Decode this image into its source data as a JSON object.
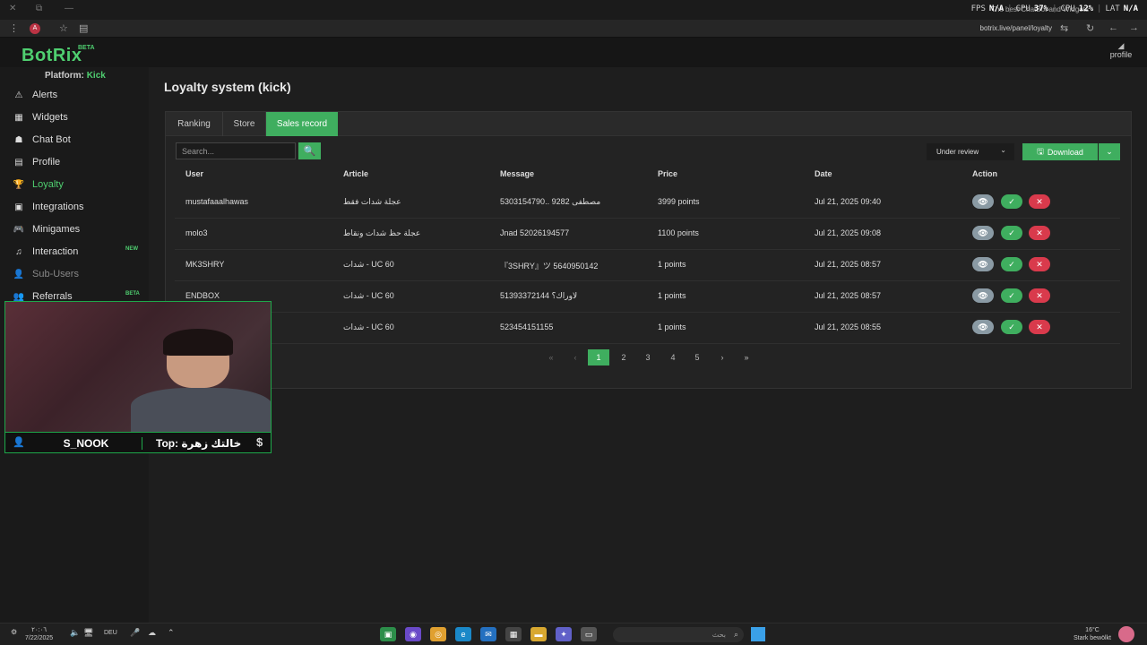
{
  "browser": {
    "window_controls": [
      "✕",
      "⧉",
      "—"
    ],
    "fps": {
      "fps_label": "FPS",
      "fps_val": "N/A",
      "gpu_label": "GPU",
      "gpu_val": "37%",
      "cpu_label": "CPU",
      "cpu_val": "12%",
      "lat_label": "LAT",
      "lat_val": "N/A"
    },
    "overlay_title": "The best ChatBot and Widgets",
    "url": "botrix.live/panel/loyalty"
  },
  "app": {
    "logo": "BotRix",
    "beta": "BETA",
    "platform_label": "Platform:",
    "platform_value": "Kick",
    "profile_label": "profile"
  },
  "sidebar": {
    "items": [
      {
        "label": "Alerts",
        "icon": "⚠"
      },
      {
        "label": "Widgets",
        "icon": "▦"
      },
      {
        "label": "Chat Bot",
        "icon": "☗"
      },
      {
        "label": "Profile",
        "icon": "▤"
      },
      {
        "label": "Loyalty",
        "icon": "🏆"
      },
      {
        "label": "Integrations",
        "icon": "▣"
      },
      {
        "label": "Minigames",
        "icon": "🎮"
      },
      {
        "label": "Interaction",
        "icon": "♫",
        "badge": "NEW"
      },
      {
        "label": "Sub-Users",
        "icon": "👤"
      },
      {
        "label": "Referrals",
        "icon": "👥",
        "badge": "BETA"
      }
    ]
  },
  "main": {
    "title": "Loyalty system (kick)",
    "tabs": [
      "Ranking",
      "Store",
      "Sales record"
    ],
    "search_placeholder": "Search...",
    "search_icon": "🔍",
    "filter_value": "Under review",
    "download_label": "Download",
    "download_icon": "🖫",
    "columns": [
      "User",
      "Article",
      "Message",
      "Price",
      "Date",
      "Action"
    ],
    "rows": [
      {
        "user": "mustafaaalhawas",
        "article": "عجلة شدات فقط",
        "message": "مصطفى 9282 ..5303154790",
        "price": "3999 points",
        "date": "Jul 21, 2025 09:40"
      },
      {
        "user": "molo3",
        "article": "عجلة حظ شدات ونقاط",
        "message": "Jnad 52026194577",
        "price": "1100 points",
        "date": "Jul 21, 2025 09:08"
      },
      {
        "user": "MK3SHRY",
        "article": "شدات - UC 60",
        "message": "『3SHRY』ツ 5640950142",
        "price": "1 points",
        "date": "Jul 21, 2025 08:57"
      },
      {
        "user": "ENDBOX",
        "article": "شدات - UC 60",
        "message": "لاوراك؟ 51393372144",
        "price": "1 points",
        "date": "Jul 21, 2025 08:57"
      },
      {
        "user": "",
        "article": "شدات - UC 60",
        "message": "523454151155",
        "price": "1 points",
        "date": "Jul 21, 2025 08:55"
      }
    ],
    "pagination": [
      "«",
      "‹",
      "1",
      "2",
      "3",
      "4",
      "5",
      "›",
      "»"
    ]
  },
  "webcam": {
    "name": "S_NOOK",
    "top": "Top: خالتك زهرة",
    "dollar": "$"
  },
  "taskbar": {
    "date_line1": "٢٠:٠٦",
    "date_line2": "7/22/2025",
    "lang": "DEU",
    "search_text": "بحث",
    "weather_temp": "16°C",
    "weather_desc": "Stark bewölkt"
  }
}
